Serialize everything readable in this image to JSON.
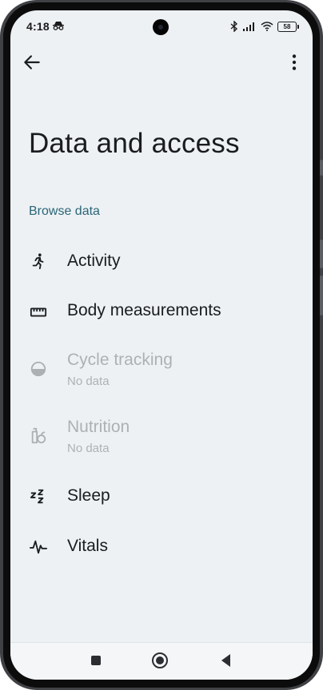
{
  "status_bar": {
    "time": "4:18",
    "battery": "58",
    "icons": [
      "incognito-icon",
      "bluetooth-icon",
      "signal-icon",
      "wifi-icon",
      "battery-icon"
    ]
  },
  "app_bar": {
    "back_icon": "arrow-back-icon",
    "more_icon": "more-vert-icon"
  },
  "page": {
    "title": "Data and access",
    "section_header": "Browse data"
  },
  "categories": [
    {
      "label": "Activity",
      "icon": "directions-run-icon",
      "subtitle": "",
      "enabled": true
    },
    {
      "label": "Body measurements",
      "icon": "straighten-ruler-icon",
      "subtitle": "",
      "enabled": true
    },
    {
      "label": "Cycle tracking",
      "icon": "cycle-tracking-icon",
      "subtitle": "No data",
      "enabled": false
    },
    {
      "label": "Nutrition",
      "icon": "nutrition-icon",
      "subtitle": "No data",
      "enabled": false
    },
    {
      "label": "Sleep",
      "icon": "sleep-zzz-icon",
      "subtitle": "",
      "enabled": true
    },
    {
      "label": "Vitals",
      "icon": "vitals-pulse-icon",
      "subtitle": "",
      "enabled": true
    }
  ],
  "nav_bar": {
    "buttons": [
      "recents-square-icon",
      "home-circle-icon",
      "back-triangle-icon"
    ]
  },
  "colors": {
    "background": "#edf1f4",
    "accent": "#2a6677",
    "text": "#1a1c1e"
  }
}
